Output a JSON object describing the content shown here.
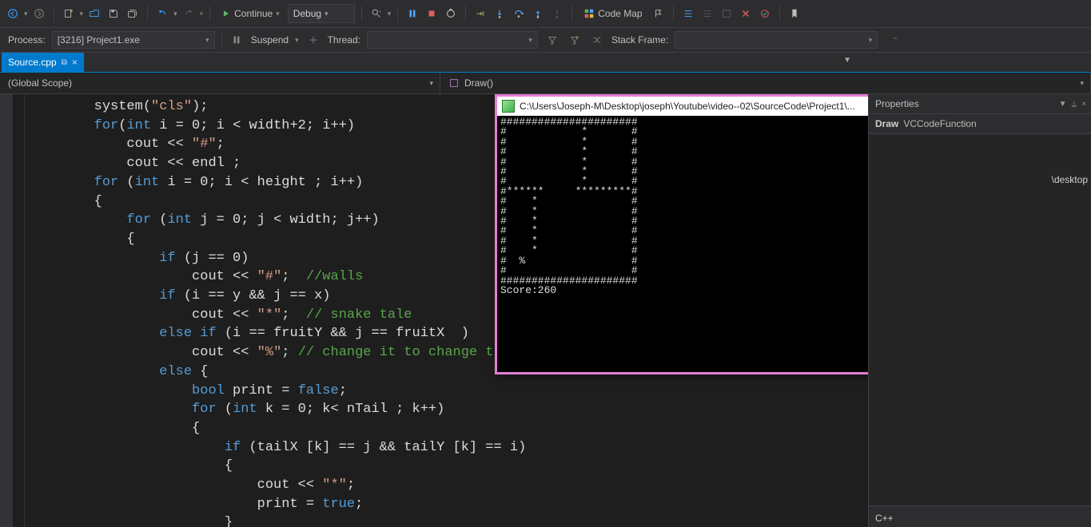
{
  "toolbar": {
    "continue_label": "Continue",
    "config_label": "Debug",
    "codemap_label": "Code Map"
  },
  "toolbar2": {
    "process_label": "Process:",
    "process_value": "[3216] Project1.exe",
    "suspend_label": "Suspend",
    "thread_label": "Thread:",
    "stackframe_label": "Stack Frame:"
  },
  "tab": {
    "filename": "Source.cpp"
  },
  "scope": {
    "left": "(Global Scope)",
    "right": "Draw()"
  },
  "code_lines": [
    {
      "indent": 2,
      "tokens": [
        {
          "t": "id",
          "v": "system("
        },
        {
          "t": "str",
          "v": "\"cls\""
        },
        {
          "t": "id",
          "v": ");"
        }
      ]
    },
    {
      "indent": 2,
      "tokens": [
        {
          "t": "kw",
          "v": "for"
        },
        {
          "t": "id",
          "v": "("
        },
        {
          "t": "typ",
          "v": "int"
        },
        {
          "t": "id",
          "v": " i = 0; i < width+2; i++)"
        }
      ]
    },
    {
      "indent": 3,
      "tokens": [
        {
          "t": "id",
          "v": "cout << "
        },
        {
          "t": "str",
          "v": "\"#\""
        },
        {
          "t": "id",
          "v": ";"
        }
      ]
    },
    {
      "indent": 3,
      "tokens": [
        {
          "t": "id",
          "v": "cout << endl ;"
        }
      ]
    },
    {
      "indent": 2,
      "tokens": [
        {
          "t": "kw",
          "v": "for"
        },
        {
          "t": "id",
          "v": " ("
        },
        {
          "t": "typ",
          "v": "int"
        },
        {
          "t": "id",
          "v": " i = 0; i < height ; i++)"
        }
      ]
    },
    {
      "indent": 2,
      "tokens": [
        {
          "t": "id",
          "v": "{"
        }
      ]
    },
    {
      "indent": 3,
      "tokens": [
        {
          "t": "kw",
          "v": "for"
        },
        {
          "t": "id",
          "v": " ("
        },
        {
          "t": "typ",
          "v": "int"
        },
        {
          "t": "id",
          "v": " j = 0; j < width; j++)"
        }
      ]
    },
    {
      "indent": 3,
      "tokens": [
        {
          "t": "id",
          "v": "{"
        }
      ]
    },
    {
      "indent": 4,
      "tokens": [
        {
          "t": "kw",
          "v": "if"
        },
        {
          "t": "id",
          "v": " (j == 0)"
        }
      ]
    },
    {
      "indent": 5,
      "tokens": [
        {
          "t": "id",
          "v": "cout << "
        },
        {
          "t": "str",
          "v": "\"#\""
        },
        {
          "t": "id",
          "v": ";  "
        },
        {
          "t": "cmt",
          "v": "//walls"
        }
      ]
    },
    {
      "indent": 4,
      "tokens": [
        {
          "t": "kw",
          "v": "if"
        },
        {
          "t": "id",
          "v": " (i == y && j == x)"
        }
      ]
    },
    {
      "indent": 5,
      "tokens": [
        {
          "t": "id",
          "v": "cout << "
        },
        {
          "t": "str",
          "v": "\"*\""
        },
        {
          "t": "id",
          "v": ";  "
        },
        {
          "t": "cmt",
          "v": "// snake tale"
        }
      ]
    },
    {
      "indent": 4,
      "tokens": [
        {
          "t": "kw",
          "v": "else if"
        },
        {
          "t": "id",
          "v": " (i == fruitY && j == fruitX  )"
        }
      ]
    },
    {
      "indent": 5,
      "tokens": [
        {
          "t": "id",
          "v": "cout << "
        },
        {
          "t": "str",
          "v": "\"%\""
        },
        {
          "t": "id",
          "v": "; "
        },
        {
          "t": "cmt",
          "v": "// change it to change the "
        }
      ]
    },
    {
      "indent": 4,
      "tokens": [
        {
          "t": "kw",
          "v": "else"
        },
        {
          "t": "id",
          "v": " {"
        }
      ]
    },
    {
      "indent": 5,
      "tokens": [
        {
          "t": "typ",
          "v": "bool"
        },
        {
          "t": "id",
          "v": " print = "
        },
        {
          "t": "kw",
          "v": "false"
        },
        {
          "t": "id",
          "v": ";"
        }
      ]
    },
    {
      "indent": 5,
      "tokens": [
        {
          "t": "kw",
          "v": "for"
        },
        {
          "t": "id",
          "v": " ("
        },
        {
          "t": "typ",
          "v": "int"
        },
        {
          "t": "id",
          "v": " k = 0; k< nTail ; k++)"
        }
      ]
    },
    {
      "indent": 5,
      "tokens": [
        {
          "t": "id",
          "v": "{"
        }
      ]
    },
    {
      "indent": 6,
      "tokens": [
        {
          "t": "kw",
          "v": "if"
        },
        {
          "t": "id",
          "v": " (tailX [k] == j && tailY [k] == i)"
        }
      ]
    },
    {
      "indent": 6,
      "tokens": [
        {
          "t": "id",
          "v": "{"
        }
      ]
    },
    {
      "indent": 7,
      "tokens": [
        {
          "t": "id",
          "v": "cout << "
        },
        {
          "t": "str",
          "v": "\"*\""
        },
        {
          "t": "id",
          "v": ";"
        }
      ]
    },
    {
      "indent": 7,
      "tokens": [
        {
          "t": "id",
          "v": "print = "
        },
        {
          "t": "kw",
          "v": "true"
        },
        {
          "t": "id",
          "v": ";"
        }
      ]
    },
    {
      "indent": 6,
      "tokens": [
        {
          "t": "id",
          "v": "}"
        }
      ]
    }
  ],
  "console": {
    "title": "C:\\Users\\Joseph-M\\Desktop\\joseph\\Youtube\\video--02\\SourceCode\\Project1\\...",
    "lines": [
      "######################",
      "#            *       #",
      "#            *       #",
      "#            *       #",
      "#            *       #",
      "#            *       #",
      "#            *       #",
      "#******     *********#",
      "#    *               #",
      "#    *               #",
      "#    *               #",
      "#    *               #",
      "#    *               #",
      "#    *               #",
      "#  %                 #",
      "#                    #",
      "######################",
      "Score:260"
    ]
  },
  "properties": {
    "panel_title": "Properties",
    "func_label": "Draw",
    "func_type": "VCCodeFunction",
    "side_tag": "\\desktop",
    "bottom_label": "C++"
  }
}
